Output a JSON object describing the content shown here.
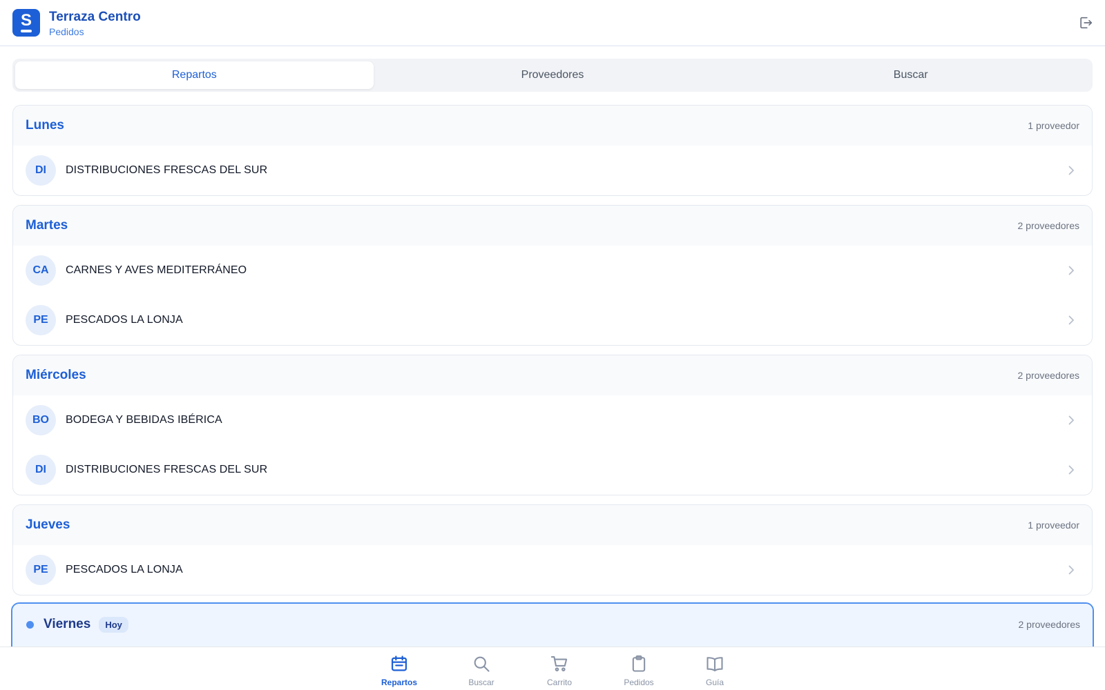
{
  "header": {
    "title": "Terraza Centro",
    "subtitle": "Pedidos",
    "logo_letter": "S",
    "logout_icon": "logout-icon"
  },
  "tabs": [
    {
      "label": "Repartos",
      "active": true
    },
    {
      "label": "Proveedores",
      "active": false
    },
    {
      "label": "Buscar",
      "active": false
    }
  ],
  "days": [
    {
      "day": "Lunes",
      "count": "1 proveedor",
      "suppliers": [
        {
          "initials": "DI",
          "name": "DISTRIBUCIONES FRESCAS DEL SUR"
        }
      ]
    },
    {
      "day": "Martes",
      "count": "2 proveedores",
      "suppliers": [
        {
          "initials": "CA",
          "name": "CARNES Y AVES MEDITERRÁNEO"
        },
        {
          "initials": "PE",
          "name": "PESCADOS LA LONJA"
        }
      ]
    },
    {
      "day": "Miércoles",
      "count": "2 proveedores",
      "suppliers": [
        {
          "initials": "BO",
          "name": "BODEGA Y BEBIDAS IBÉRICA"
        },
        {
          "initials": "DI",
          "name": "DISTRIBUCIONES FRESCAS DEL SUR"
        }
      ]
    },
    {
      "day": "Jueves",
      "count": "1 proveedor",
      "suppliers": [
        {
          "initials": "PE",
          "name": "PESCADOS LA LONJA"
        }
      ]
    }
  ],
  "today": {
    "day": "Viernes",
    "badge": "Hoy",
    "count": "2 proveedores"
  },
  "bottom_nav": [
    {
      "label": "Repartos",
      "icon": "calendar-icon",
      "active": true
    },
    {
      "label": "Buscar",
      "icon": "search-icon",
      "active": false
    },
    {
      "label": "Carrito",
      "icon": "cart-icon",
      "active": false
    },
    {
      "label": "Pedidos",
      "icon": "clipboard-icon",
      "active": false
    },
    {
      "label": "Guía",
      "icon": "book-icon",
      "active": false
    }
  ],
  "colors": {
    "accent": "#1d5fd6",
    "today_border": "#4f8ff0",
    "today_bg": "#eef5ff",
    "avatar_bg": "#e6eefb"
  }
}
